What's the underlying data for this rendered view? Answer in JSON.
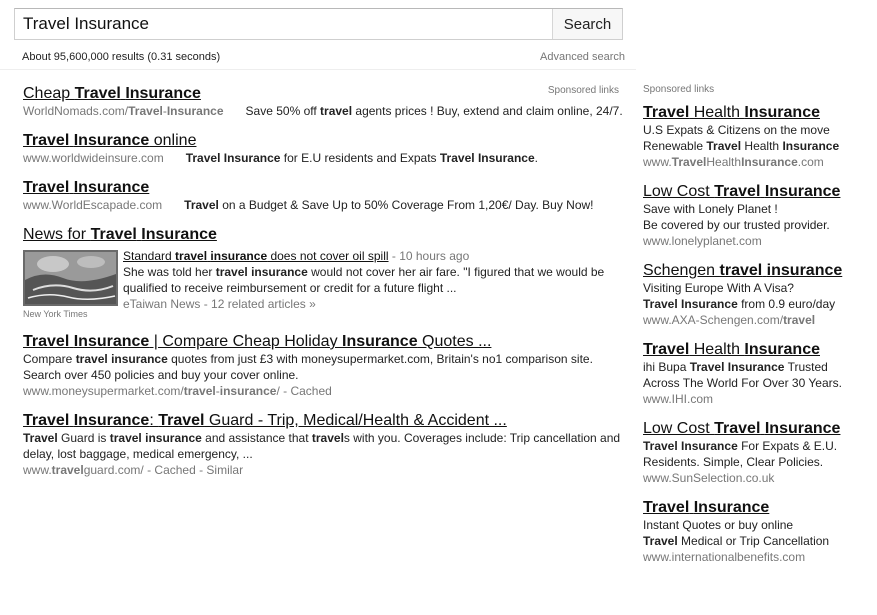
{
  "search": {
    "query": "Travel Insurance",
    "button": "Search"
  },
  "stats": "About 95,600,000 results (0.31 seconds)",
  "advanced_search": "Advanced search",
  "sponsored_label": "Sponsored links",
  "sponsored_results": [
    {
      "title": "Cheap Travel Insurance",
      "url": "WorldNomads.com/Travel-Insurance",
      "desc": "Save 50% off travel agents prices ! Buy, extend and claim online, 24/7."
    },
    {
      "title": "Travel Insurance online",
      "url": "www.worldwideinsure.com",
      "desc": "Travel Insurance for E.U residents and Expats Travel Insurance."
    },
    {
      "title": "Travel Insurance",
      "url": "www.WorldEscapade.com",
      "desc": "Travel on a Budget & Save Up to 50% Coverage From 1,20€/ Day. Buy Now!"
    }
  ],
  "news": {
    "heading": "News for Travel Insurance",
    "title": "Standard travel insurance does not cover oil spill",
    "time": " - 10 hours ago",
    "snippet": "She was told her travel insurance would not cover her air fare. \"I figured that we would be qualified to receive reimbursement or credit for a future flight ...",
    "source": "eTaiwan News - 12 related articles »",
    "image_source": "New York Times"
  },
  "organic_results": [
    {
      "title": "Travel Insurance | Compare Cheap Holiday Insurance Quotes ...",
      "desc": "Compare travel insurance quotes from just £3 with moneysupermarket.com, Britain's no1 comparison site. Search over 450 policies and buy your cover online.",
      "url": "www.moneysupermarket.com/travel-insurance/ - Cached"
    },
    {
      "title": "Travel Insurance: Travel Guard - Trip, Medical/Health & Accident ...",
      "desc": "Travel Guard is travel insurance and assistance that travels with you. Coverages include: Trip cancellation and delay, lost baggage, medical emergency, ...",
      "url": "www.travelguard.com/ - Cached - Similar"
    }
  ],
  "side_ads": [
    {
      "title": "Travel Health Insurance",
      "lines": [
        "U.S Expats & Citizens on the move",
        "Renewable Travel Health Insurance"
      ],
      "url": "www.TravelHealthInsurance.com"
    },
    {
      "title": "Low Cost Travel Insurance",
      "lines": [
        "Save with Lonely Planet !",
        "Be covered by our trusted provider."
      ],
      "url": "www.lonelyplanet.com"
    },
    {
      "title": "Schengen travel insurance",
      "lines": [
        "Visiting Europe With A Visa?",
        "Travel Insurance from 0.9 euro/day"
      ],
      "url": "www.AXA-Schengen.com/travel"
    },
    {
      "title": "Travel Health Insurance",
      "lines": [
        "ihi Bupa Travel Insurance Trusted",
        "Across The World For Over 30 Years."
      ],
      "url": "www.IHI.com"
    },
    {
      "title": "Low Cost Travel Insurance",
      "lines": [
        "Travel Insurance For Expats & E.U.",
        "Residents. Simple, Clear Policies."
      ],
      "url": "www.SunSelection.co.uk"
    },
    {
      "title": "Travel Insurance",
      "lines": [
        "Instant Quotes or buy online",
        "Travel Medical or Trip Cancellation"
      ],
      "url": "www.internationalbenefits.com"
    }
  ]
}
